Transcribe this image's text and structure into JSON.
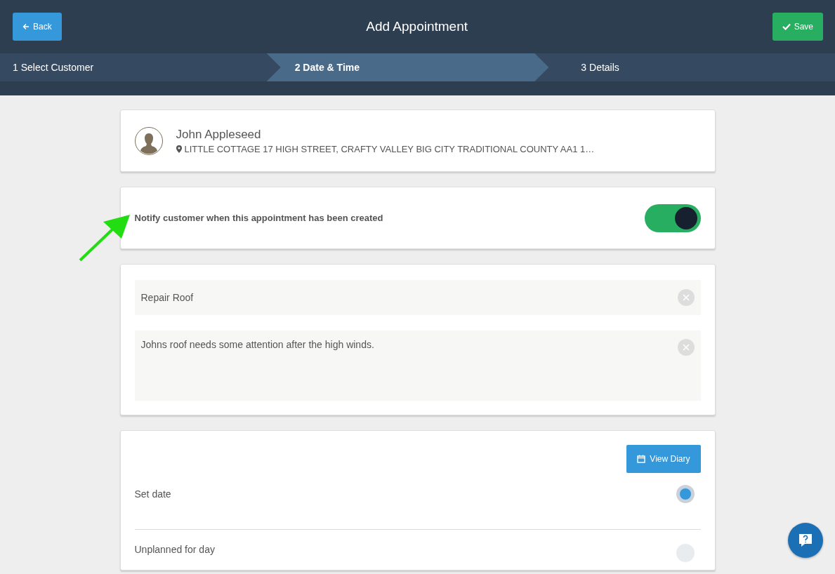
{
  "header": {
    "title": "Add Appointment",
    "back_button": "Back",
    "save_button": "Save"
  },
  "steps": [
    {
      "label": "1 Select Customer",
      "selected": false
    },
    {
      "label": "2 Date & Time",
      "selected": true
    },
    {
      "label": "3 Details",
      "selected": false
    }
  ],
  "customer": {
    "name": "John Appleseed",
    "address": "LITTLE COTTAGE 17 HIGH STREET, CRAFTY VALLEY BIG CITY TRADITIONAL COUNTY AA1 1…"
  },
  "notify": {
    "label": "Notify customer when this appointment has been created",
    "on": true
  },
  "fields": [
    {
      "kind": "line",
      "value": "Repair Roof"
    },
    {
      "kind": "area",
      "value": "Johns roof needs some attention after the high winds."
    }
  ],
  "schedule": {
    "view_diary_button": "View Diary",
    "options": [
      {
        "label": "Set date",
        "selected": true
      },
      {
        "label": "Unplanned for day",
        "selected": false
      }
    ]
  }
}
